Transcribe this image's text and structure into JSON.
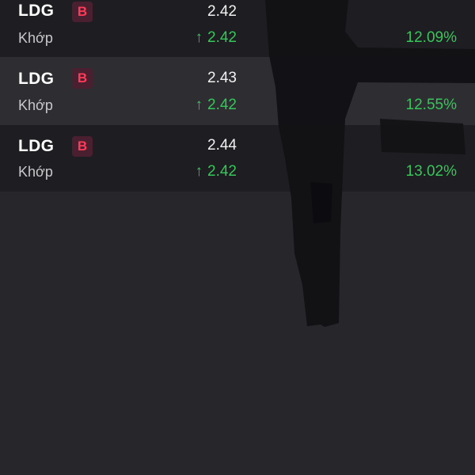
{
  "rows": [
    {
      "symbol": "LDG",
      "side_badge": "B",
      "price": "2.42",
      "status": "Khớp",
      "matched_price": "2.42",
      "change_pct": "12.09%"
    },
    {
      "symbol": "LDG",
      "side_badge": "B",
      "price": "2.43",
      "status": "Khớp",
      "matched_price": "2.42",
      "change_pct": "12.55%"
    },
    {
      "symbol": "LDG",
      "side_badge": "B",
      "price": "2.44",
      "status": "Khớp",
      "matched_price": "2.42",
      "change_pct": "13.02%"
    }
  ],
  "icons": {
    "up_arrow": "↑"
  },
  "colors": {
    "up": "#35c759",
    "buy_badge": "#ff3b57",
    "background": "#27262b"
  }
}
